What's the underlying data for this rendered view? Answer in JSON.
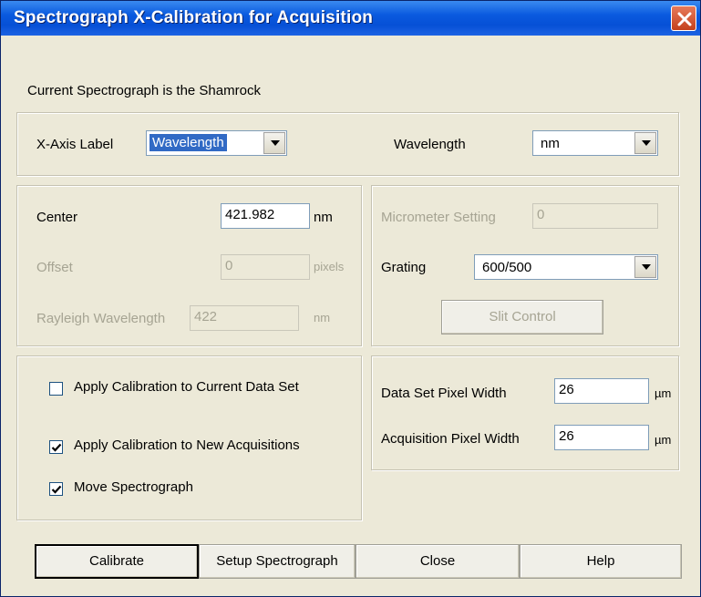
{
  "window": {
    "title": "Spectrograph X-Calibration for Acquisition"
  },
  "header": {
    "current_spectrograph": "Current Spectrograph is the Shamrock"
  },
  "axis": {
    "x_axis_label": "X-Axis Label",
    "x_axis_value": "Wavelength",
    "units_label": "Wavelength",
    "units_value": "nm"
  },
  "calib": {
    "center_label": "Center",
    "center_value": "421.982",
    "center_unit": "nm",
    "offset_label": "Offset",
    "offset_value": "0",
    "offset_unit": "pixels",
    "rayleigh_label": "Rayleigh Wavelength",
    "rayleigh_value": "422",
    "rayleigh_unit": "nm"
  },
  "spectro": {
    "micrometer_label": "Micrometer Setting",
    "micrometer_value": "0",
    "grating_label": "Grating",
    "grating_value": "600/500",
    "slit_control_label": "Slit Control"
  },
  "options": {
    "apply_current": {
      "label": "Apply Calibration to Current Data Set",
      "checked": false
    },
    "apply_new": {
      "label": "Apply Calibration to New Acquisitions",
      "checked": true
    },
    "move_spectrograph": {
      "label": "Move Spectrograph",
      "checked": true
    }
  },
  "pixel": {
    "data_set_label": "Data Set Pixel Width",
    "data_set_value": "26",
    "data_set_unit": "µm",
    "acquisition_label": "Acquisition Pixel Width",
    "acquisition_value": "26",
    "acquisition_unit": "µm"
  },
  "buttons": {
    "calibrate": "Calibrate",
    "setup": "Setup Spectrograph",
    "close": "Close",
    "help": "Help"
  }
}
